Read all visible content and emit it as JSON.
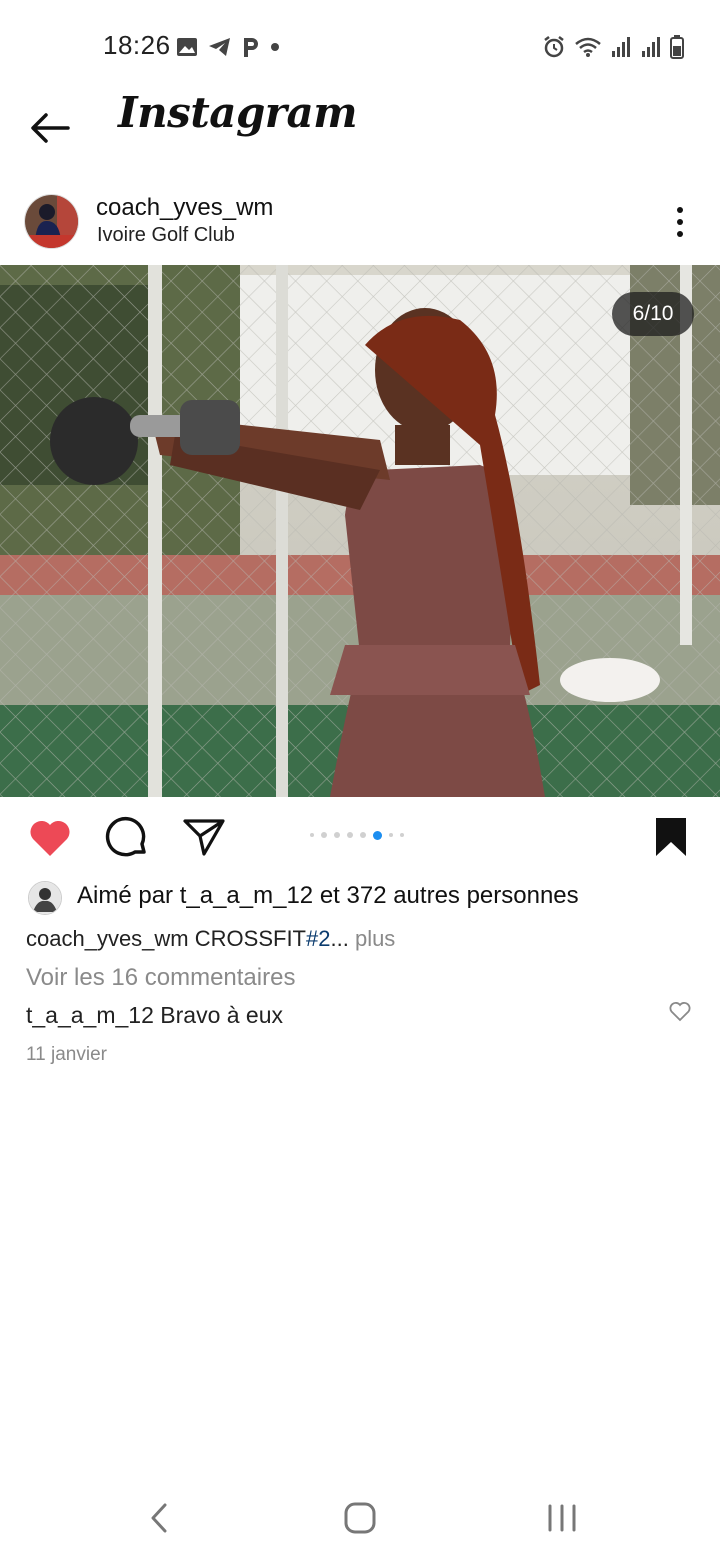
{
  "status_bar": {
    "time": "18:26",
    "left_icons": [
      "image-icon",
      "telegram-icon",
      "p-icon",
      "dot-icon"
    ],
    "right_icons": [
      "alarm-icon",
      "wifi-icon",
      "signal-icon",
      "signal-icon",
      "battery-icon"
    ]
  },
  "header": {
    "app_title": "Instagram",
    "back_icon": "arrow-left-icon"
  },
  "post": {
    "username": "coach_yves_wm",
    "location": "Ivoire Golf Club",
    "media_counter": "6/10",
    "carousel": {
      "total_dots": 7,
      "active_index": 4
    },
    "likes_text": "Aimé par t_a_a_m_12 et 372 autres personnes",
    "caption": {
      "username": "coach_yves_wm",
      "text": "CROSSFIT",
      "hashtag": "#2",
      "ellipsis": "...",
      "more": "plus"
    },
    "view_comments": "Voir les 16 commentaires",
    "comment": {
      "username": "t_a_a_m_12",
      "text": "Bravo à eux"
    },
    "date": "11 janvier"
  },
  "colors": {
    "like_red": "#ed4956",
    "link_blue": "#0b3b6e",
    "active_dot": "#1c8ef0",
    "muted_text": "#8a8a8a"
  },
  "nav_bar": [
    "back-icon",
    "home-icon",
    "recent-apps-icon"
  ]
}
